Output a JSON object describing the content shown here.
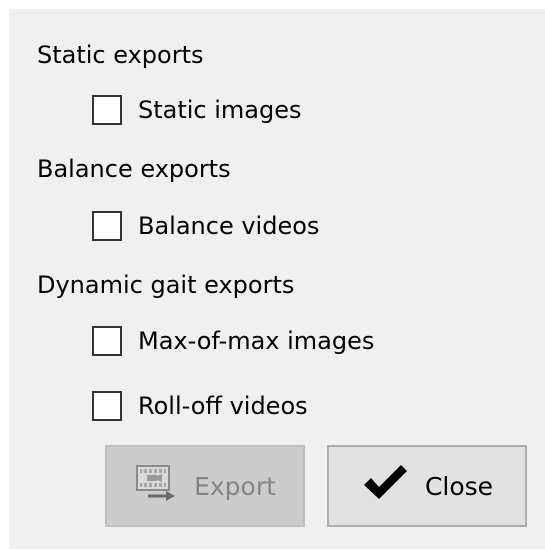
{
  "sections": [
    {
      "label": "Static exports",
      "options": [
        {
          "label": "Static images",
          "checked": false
        }
      ]
    },
    {
      "label": "Balance exports",
      "options": [
        {
          "label": "Balance videos",
          "checked": false
        }
      ]
    },
    {
      "label": "Dynamic gait exports",
      "options": [
        {
          "label": "Max-of-max images",
          "checked": false
        },
        {
          "label": "Roll-off videos",
          "checked": false
        }
      ]
    }
  ],
  "buttons": {
    "export": {
      "label": "Export",
      "icon": "film-export-icon",
      "enabled": false
    },
    "close": {
      "label": "Close",
      "icon": "checkmark-icon",
      "enabled": true
    }
  }
}
